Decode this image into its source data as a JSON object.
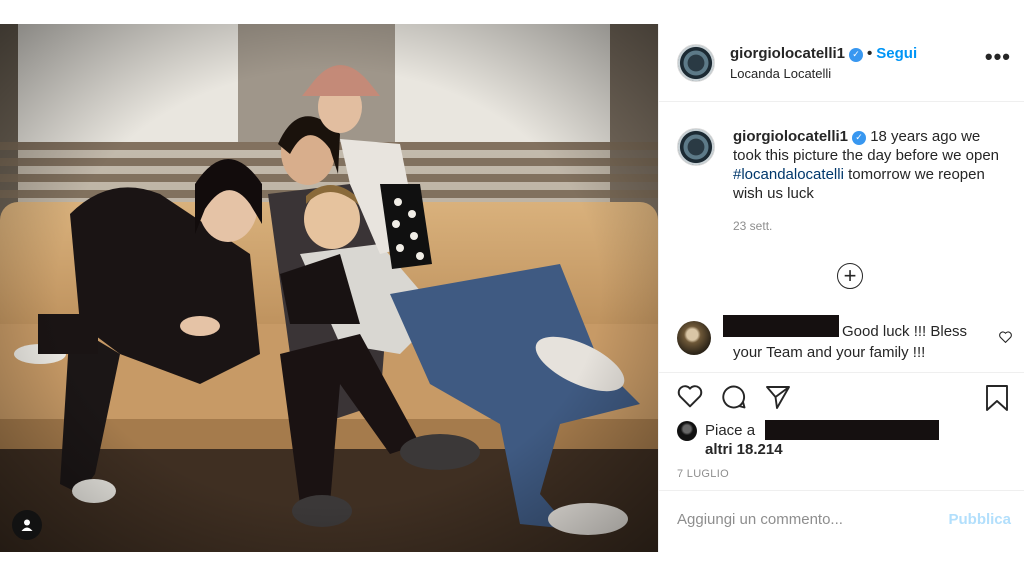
{
  "header": {
    "username": "giorgiolocatelli1",
    "separator": "•",
    "follow_label": "Segui",
    "location": "Locanda Locatelli",
    "more_icon": "more-horizontal-icon"
  },
  "caption": {
    "username": "giorgiolocatelli1",
    "text_before": " 18 years ago we took this picture the day before we open ",
    "hashtag": "#locandalocatelli",
    "text_after": " tomorrow we reopen wish us luck",
    "time": "23 sett."
  },
  "comment": {
    "text": "Good luck !!! Bless your Team and your family !!!"
  },
  "likes": {
    "prefix": "Piace a",
    "others": "altri 18.214"
  },
  "post_date": "7 LUGLIO",
  "comment_box": {
    "placeholder": "Aggiungi un commento...",
    "publish_label": "Pubblica"
  },
  "colors": {
    "accent": "#0095f6",
    "verified": "#3897f0",
    "hashtag": "#00376b",
    "muted": "#8e8e8e"
  }
}
